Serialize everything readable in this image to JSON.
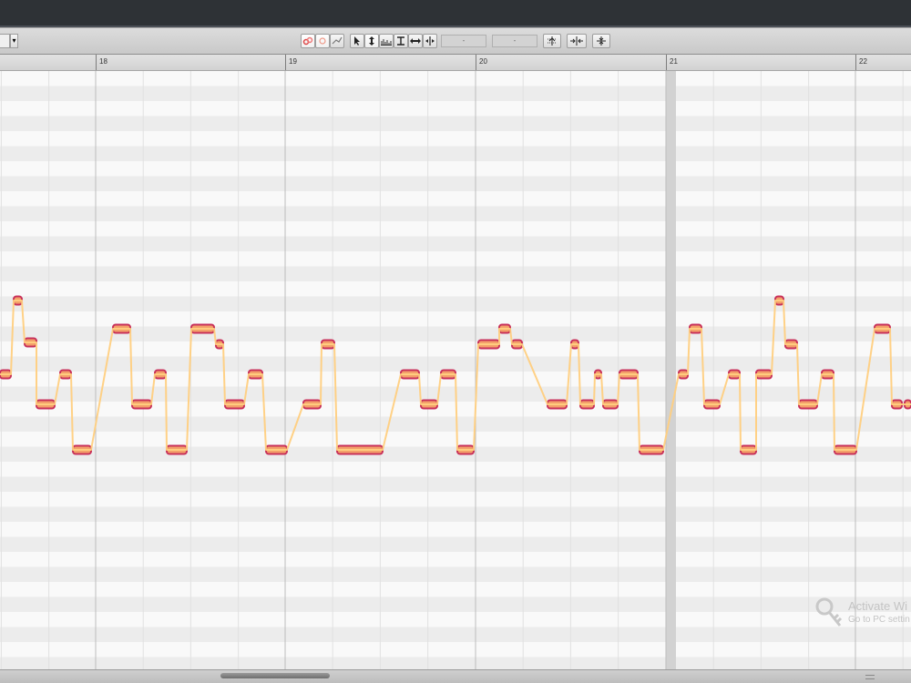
{
  "toolbar": {
    "tools": [
      {
        "icon": "pitch-modulation-icon"
      },
      {
        "icon": "pitch-drift-icon"
      },
      {
        "icon": "vibrato-icon"
      },
      {
        "icon": "main-tool-arrow-icon"
      },
      {
        "icon": "pitch-tool-icon"
      },
      {
        "icon": "formant-tool-icon"
      },
      {
        "icon": "amplitude-tool-icon"
      },
      {
        "icon": "time-tool-icon"
      },
      {
        "icon": "separation-tool-icon"
      }
    ],
    "field_1_value": "-",
    "field_2_value": "-",
    "macro_buttons": [
      {
        "icon": "correct-pitch-icon"
      },
      {
        "icon": "quantize-time-icon"
      },
      {
        "icon": "edit-level-icon"
      }
    ]
  },
  "ruler": {
    "bars": [
      "18",
      "19",
      "20",
      "21",
      "22"
    ]
  },
  "watermark": {
    "title": "Activate Wi",
    "subtitle": "Go to PC settin"
  },
  "colors": {
    "blob_outline": "#c8305a",
    "blob_fill": "#f3a06a",
    "pitch_line": "#ffcf80",
    "lane_dark": "#ececec",
    "lane_light": "#f9f9f9"
  }
}
